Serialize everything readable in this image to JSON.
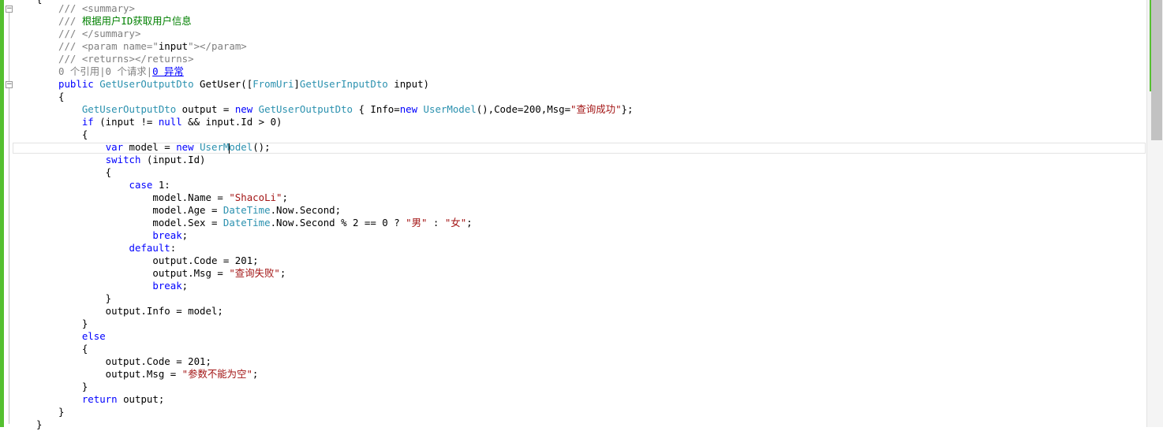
{
  "editor": {
    "lines": [
      [
        {
          "c": "doc",
          "t": "/// <summary>"
        }
      ],
      [
        {
          "c": "doc",
          "t": "/// "
        },
        {
          "c": "com",
          "t": "根据用户ID获取用户信息"
        }
      ],
      [
        {
          "c": "doc",
          "t": "/// </summary>"
        }
      ],
      [
        {
          "c": "doc",
          "t": "/// <param name=\""
        },
        {
          "c": "",
          "t": "input"
        },
        {
          "c": "doc",
          "t": "\"></param>"
        }
      ],
      [
        {
          "c": "doc",
          "t": "/// <returns></returns>"
        }
      ],
      [
        {
          "c": "lens",
          "t": "0 个引用|0 个请求|"
        },
        {
          "c": "lens-link",
          "t": "0 异常"
        }
      ],
      [
        {
          "c": "kw",
          "t": "public "
        },
        {
          "c": "ty",
          "t": "GetUserOutputDto"
        },
        {
          "c": "",
          "t": " GetUser(["
        },
        {
          "c": "ty",
          "t": "FromUri"
        },
        {
          "c": "",
          "t": "]"
        },
        {
          "c": "ty",
          "t": "GetUserInputDto"
        },
        {
          "c": "",
          "t": " input)"
        }
      ],
      [
        {
          "c": "",
          "t": "{"
        }
      ],
      [
        {
          "c": "",
          "t": "    "
        },
        {
          "c": "ty",
          "t": "GetUserOutputDto"
        },
        {
          "c": "",
          "t": " output = "
        },
        {
          "c": "kw",
          "t": "new "
        },
        {
          "c": "ty",
          "t": "GetUserOutputDto"
        },
        {
          "c": "",
          "t": " { Info="
        },
        {
          "c": "kw",
          "t": "new "
        },
        {
          "c": "ty",
          "t": "UserModel"
        },
        {
          "c": "",
          "t": "(),Code=200,Msg="
        },
        {
          "c": "str",
          "t": "\"查询成功\""
        },
        {
          "c": "",
          "t": "};"
        }
      ],
      [
        {
          "c": "",
          "t": "    "
        },
        {
          "c": "kw",
          "t": "if"
        },
        {
          "c": "",
          "t": " (input != "
        },
        {
          "c": "kw",
          "t": "null"
        },
        {
          "c": "",
          "t": " && input.Id > 0)"
        }
      ],
      [
        {
          "c": "",
          "t": "    {"
        }
      ],
      [
        {
          "c": "",
          "t": "        "
        },
        {
          "c": "kw",
          "t": "var"
        },
        {
          "c": "",
          "t": " model = "
        },
        {
          "c": "kw",
          "t": "new "
        },
        {
          "c": "ty",
          "t": "UserModel"
        },
        {
          "c": "",
          "t": "();"
        }
      ],
      [
        {
          "c": "",
          "t": "        "
        },
        {
          "c": "kw",
          "t": "switch"
        },
        {
          "c": "",
          "t": " (input.Id)"
        }
      ],
      [
        {
          "c": "",
          "t": "        {"
        }
      ],
      [
        {
          "c": "",
          "t": "            "
        },
        {
          "c": "kw",
          "t": "case"
        },
        {
          "c": "",
          "t": " 1:"
        }
      ],
      [
        {
          "c": "",
          "t": "                model.Name = "
        },
        {
          "c": "str",
          "t": "\"ShacoLi\""
        },
        {
          "c": "",
          "t": ";"
        }
      ],
      [
        {
          "c": "",
          "t": "                model.Age = "
        },
        {
          "c": "ty",
          "t": "DateTime"
        },
        {
          "c": "",
          "t": ".Now.Second;"
        }
      ],
      [
        {
          "c": "",
          "t": "                model.Sex = "
        },
        {
          "c": "ty",
          "t": "DateTime"
        },
        {
          "c": "",
          "t": ".Now.Second % 2 == 0 ? "
        },
        {
          "c": "str",
          "t": "\"男\""
        },
        {
          "c": "",
          "t": " : "
        },
        {
          "c": "str",
          "t": "\"女\""
        },
        {
          "c": "",
          "t": ";"
        }
      ],
      [
        {
          "c": "",
          "t": "                "
        },
        {
          "c": "kw",
          "t": "break"
        },
        {
          "c": "",
          "t": ";"
        }
      ],
      [
        {
          "c": "",
          "t": "            "
        },
        {
          "c": "kw",
          "t": "default"
        },
        {
          "c": "",
          "t": ":"
        }
      ],
      [
        {
          "c": "",
          "t": "                output.Code = 201;"
        }
      ],
      [
        {
          "c": "",
          "t": "                output.Msg = "
        },
        {
          "c": "str",
          "t": "\"查询失败\""
        },
        {
          "c": "",
          "t": ";"
        }
      ],
      [
        {
          "c": "",
          "t": "                "
        },
        {
          "c": "kw",
          "t": "break"
        },
        {
          "c": "",
          "t": ";"
        }
      ],
      [
        {
          "c": "",
          "t": "        }"
        }
      ],
      [
        {
          "c": "",
          "t": "        output.Info = model;"
        }
      ],
      [
        {
          "c": "",
          "t": "    }"
        }
      ],
      [
        {
          "c": "",
          "t": "    "
        },
        {
          "c": "kw",
          "t": "else"
        }
      ],
      [
        {
          "c": "",
          "t": "    {"
        }
      ],
      [
        {
          "c": "",
          "t": "        output.Code = 201;"
        }
      ],
      [
        {
          "c": "",
          "t": "        output.Msg = "
        },
        {
          "c": "str",
          "t": "\"参数不能为空\""
        },
        {
          "c": "",
          "t": ";"
        }
      ],
      [
        {
          "c": "",
          "t": "    }"
        }
      ],
      [
        {
          "c": "",
          "t": "    "
        },
        {
          "c": "kw",
          "t": "return"
        },
        {
          "c": "",
          "t": " output;"
        }
      ],
      [
        {
          "c": "",
          "t": "}"
        }
      ]
    ],
    "top_fragment": "{",
    "bottom_fragment": "}",
    "fold_glyph": "−"
  }
}
